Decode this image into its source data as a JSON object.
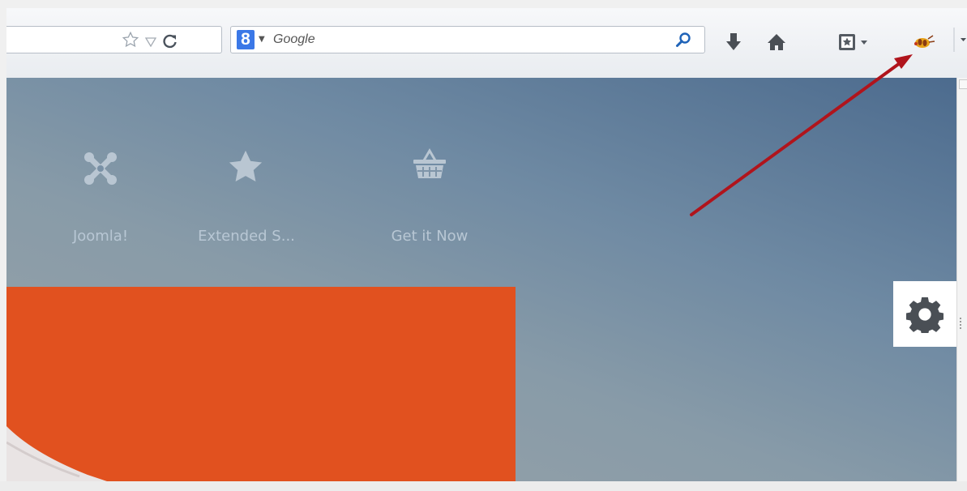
{
  "toolbar": {
    "search": {
      "engine_letter": "8",
      "placeholder": "Google",
      "value": ""
    },
    "icons": [
      "bookmark-star-icon",
      "history-dropdown-icon",
      "reload-icon",
      "search-engine-icon",
      "magnifier-icon",
      "download-icon",
      "home-icon",
      "bookmarks-menu-icon",
      "extension-icon",
      "overflow-menu-icon"
    ]
  },
  "page": {
    "tiles": [
      {
        "label": "Joomla!",
        "icon": "joomla-logo-icon"
      },
      {
        "label": "Extended S...",
        "icon": "star-icon"
      },
      {
        "label": "Get it Now",
        "icon": "shopping-basket-icon"
      }
    ],
    "colors": {
      "hero_panel": "#e1511f",
      "annotation_arrow": "#b0141c",
      "background_top": "#4c6b8e",
      "background_bottom": "#9aa3a9"
    }
  }
}
